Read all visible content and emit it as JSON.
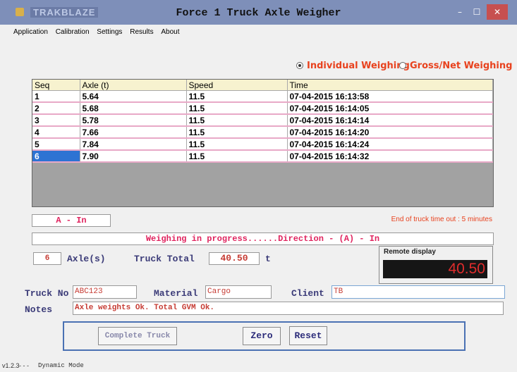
{
  "window": {
    "title": "Force 1 Truck Axle Weigher",
    "logo_text": "TRAKBLAZE"
  },
  "menu": {
    "items": [
      "Application",
      "Calibration",
      "Settings",
      "Results",
      "About"
    ]
  },
  "mode": {
    "individual_label": "Individual Weighing",
    "gross_label": "Gross/Net Weighing",
    "selected": "Individual Weighing"
  },
  "table": {
    "headers": [
      "Seq",
      "Axle (t)",
      "Speed",
      "Time"
    ],
    "rows": [
      [
        "1",
        "5.64",
        "11.5",
        "07-04-2015 16:13:58"
      ],
      [
        "2",
        "5.68",
        "11.5",
        "07-04-2015 16:14:05"
      ],
      [
        "3",
        "5.78",
        "11.5",
        "07-04-2015 16:14:14"
      ],
      [
        "4",
        "7.66",
        "11.5",
        "07-04-2015 16:14:20"
      ],
      [
        "5",
        "7.84",
        "11.5",
        "07-04-2015 16:14:24"
      ],
      [
        "6",
        "7.90",
        "11.5",
        "07-04-2015 16:14:32"
      ]
    ],
    "selected_row": 6
  },
  "status": {
    "direction_box": "A - In",
    "timeout": "End of truck time out : 5 minutes",
    "progress": "Weighing in progress......Direction - (A) - In"
  },
  "summary": {
    "axle_count": "6",
    "axle_label": "Axle(s)",
    "truck_total_label": "Truck Total",
    "truck_total": "40.50",
    "unit": "t"
  },
  "remote": {
    "label": "Remote display",
    "value": "40.50"
  },
  "details": {
    "truck_no_label": "Truck No",
    "truck_no": "ABC123",
    "material_label": "Material",
    "material": "Cargo",
    "client_label": "Client",
    "client": "TB",
    "notes_label": "Notes",
    "notes": "Axle weights Ok.  Total GVM Ok."
  },
  "buttons": {
    "complete": "Complete Truck",
    "zero": "Zero",
    "reset": "Reset"
  },
  "statusbar": {
    "version": "v1.2.3",
    "separator": "- - -",
    "mode": "Dynamic Mode"
  },
  "colors": {
    "title_bar": "#7e8fb9",
    "accent_red": "#e8421e",
    "label_blue": "#3b3b78"
  }
}
